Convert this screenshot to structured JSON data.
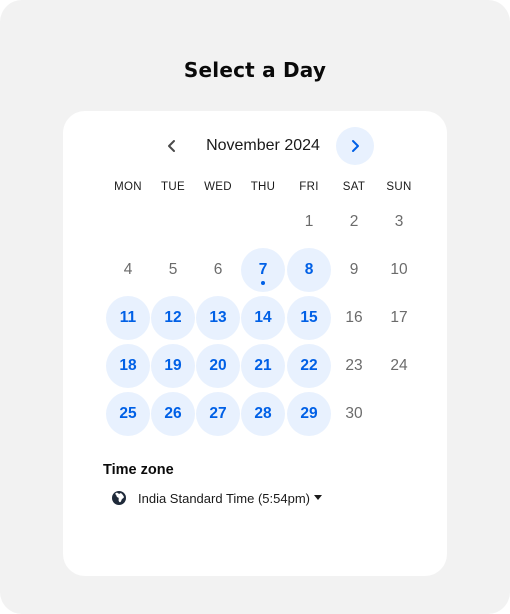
{
  "page": {
    "title": "Select a Day"
  },
  "calendar": {
    "month_label": "November 2024",
    "prev_icon": "chevron-left-icon",
    "next_icon": "chevron-right-icon",
    "weekdays": [
      "MON",
      "TUE",
      "WED",
      "THU",
      "FRI",
      "SAT",
      "SUN"
    ],
    "days": [
      {
        "label": "1",
        "available": false
      },
      {
        "label": "2",
        "available": false
      },
      {
        "label": "3",
        "available": false
      },
      {
        "label": "4",
        "available": false
      },
      {
        "label": "5",
        "available": false
      },
      {
        "label": "6",
        "available": false
      },
      {
        "label": "7",
        "available": true,
        "today": true
      },
      {
        "label": "8",
        "available": true
      },
      {
        "label": "9",
        "available": false
      },
      {
        "label": "10",
        "available": false
      },
      {
        "label": "11",
        "available": true
      },
      {
        "label": "12",
        "available": true
      },
      {
        "label": "13",
        "available": true
      },
      {
        "label": "14",
        "available": true
      },
      {
        "label": "15",
        "available": true
      },
      {
        "label": "16",
        "available": false
      },
      {
        "label": "17",
        "available": false
      },
      {
        "label": "18",
        "available": true
      },
      {
        "label": "19",
        "available": true
      },
      {
        "label": "20",
        "available": true
      },
      {
        "label": "21",
        "available": true
      },
      {
        "label": "22",
        "available": true
      },
      {
        "label": "23",
        "available": false
      },
      {
        "label": "24",
        "available": false
      },
      {
        "label": "25",
        "available": true
      },
      {
        "label": "26",
        "available": true
      },
      {
        "label": "27",
        "available": true
      },
      {
        "label": "28",
        "available": true
      },
      {
        "label": "29",
        "available": true
      },
      {
        "label": "30",
        "available": false
      }
    ]
  },
  "timezone": {
    "label": "Time zone",
    "value": "India Standard Time (5:54pm)",
    "icon": "globe-icon",
    "caret_icon": "caret-down-icon"
  },
  "colors": {
    "accent": "#0060e6",
    "available_bg": "#e8f1fe",
    "page_bg": "#f2f2f2",
    "card_bg": "#ffffff"
  }
}
